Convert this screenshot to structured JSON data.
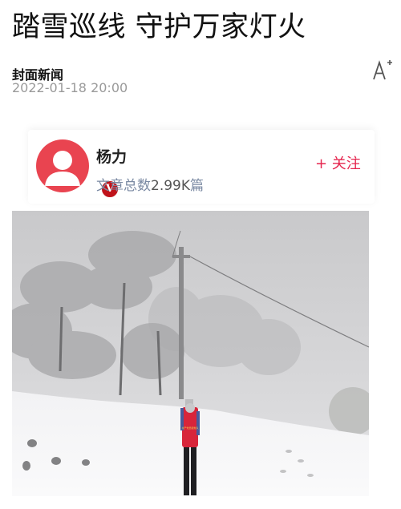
{
  "article": {
    "title": "踏雪巡线 守护万家灯火",
    "source": "封面新闻",
    "date": "2022-01-18 20:00"
  },
  "author": {
    "name": "杨力",
    "stats_prefix": "文章总数",
    "article_count": "2.99K",
    "stats_suffix": "篇",
    "badge": "V",
    "follow_label": "+ 关注"
  },
  "icons": {
    "font_size": "font-size-icon",
    "avatar": "avatar-person-icon",
    "verified": "verified-v-badge-icon"
  },
  "photo": {
    "vest_text": "共产党员服务队"
  },
  "colors": {
    "accent": "#e5254e",
    "avatar_bg": "#e94450",
    "meta": "#9a9a9a",
    "stats": "#7b8aa3"
  }
}
